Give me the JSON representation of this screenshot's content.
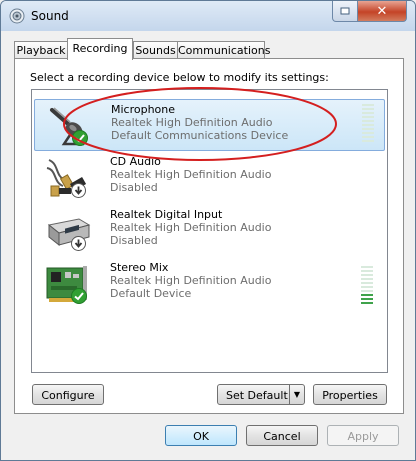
{
  "window": {
    "title": "Sound",
    "close_glyph": "✕",
    "minimize_glyph": "▫"
  },
  "tabs": [
    {
      "label": "Playback",
      "active": false
    },
    {
      "label": "Recording",
      "active": true
    },
    {
      "label": "Sounds",
      "active": false
    },
    {
      "label": "Communications",
      "active": false
    }
  ],
  "instruction": "Select a recording device below to modify its settings:",
  "devices": [
    {
      "name": "Microphone",
      "driver": "Realtek High Definition Audio",
      "status": "Default Communications Device",
      "icon": "microphone-icon",
      "badge": "check",
      "selected": true,
      "level": 0
    },
    {
      "name": "CD Audio",
      "driver": "Realtek High Definition Audio",
      "status": "Disabled",
      "icon": "cd-audio-cable-icon",
      "badge": "disabled",
      "selected": false
    },
    {
      "name": "Realtek Digital Input",
      "driver": "Realtek High Definition Audio",
      "status": "Disabled",
      "icon": "digital-input-icon",
      "badge": "disabled",
      "selected": false
    },
    {
      "name": "Stereo Mix",
      "driver": "Realtek High Definition Audio",
      "status": "Default Device",
      "icon": "sound-card-icon",
      "badge": "check",
      "selected": false,
      "level": 0.25
    }
  ],
  "buttons": {
    "configure": "Configure",
    "set_default": "Set Default",
    "properties": "Properties",
    "ok": "OK",
    "cancel": "Cancel",
    "apply": "Apply"
  },
  "colors": {
    "annotation_ellipse": "#d41f1f",
    "selection": "#cce6f8",
    "meter_on": "#3fa34b"
  }
}
